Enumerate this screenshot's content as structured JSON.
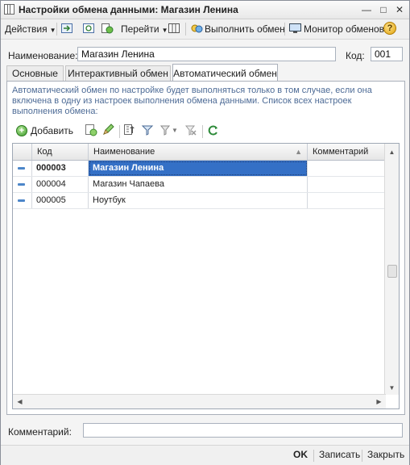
{
  "window": {
    "title": "Настройки обмена данными: Магазин Ленина"
  },
  "toolbar": {
    "actions_label": "Действия",
    "goto_label": "Перейти",
    "execute_label": "Выполнить обмен",
    "monitor_label": "Монитор обменов",
    "help_glyph": "?"
  },
  "form": {
    "name_label": "Наименование:",
    "name_value": "Магазин Ленина",
    "code_label": "Код:",
    "code_value": "001",
    "comment_label": "Комментарий:",
    "comment_value": ""
  },
  "tabs": [
    {
      "label": "Основные",
      "active": false
    },
    {
      "label": "Интерактивный обмен",
      "active": false
    },
    {
      "label": "Автоматический обмен",
      "active": true
    }
  ],
  "auto_tab": {
    "info_text": "Автоматический обмен по настройке будет выполняться только в том случае, если она включена в одну из настроек выполнения обмена данными. Список всех настроек выполнения обмена:",
    "add_label": "Добавить"
  },
  "table": {
    "columns": [
      "Код",
      "Наименование",
      "Комментарий"
    ],
    "rows": [
      {
        "code": "000003",
        "name": "Магазин Ленина",
        "comment": "",
        "selected": true
      },
      {
        "code": "000004",
        "name": "Магазин Чапаева",
        "comment": "",
        "selected": false
      },
      {
        "code": "000005",
        "name": "Ноутбук",
        "comment": "",
        "selected": false
      }
    ]
  },
  "footer": {
    "ok_label": "OK",
    "save_label": "Записать",
    "close_label": "Закрыть"
  },
  "colors": {
    "selection": "#3470c6",
    "info_text": "#4d6b96",
    "accent": "#4c86c9"
  }
}
